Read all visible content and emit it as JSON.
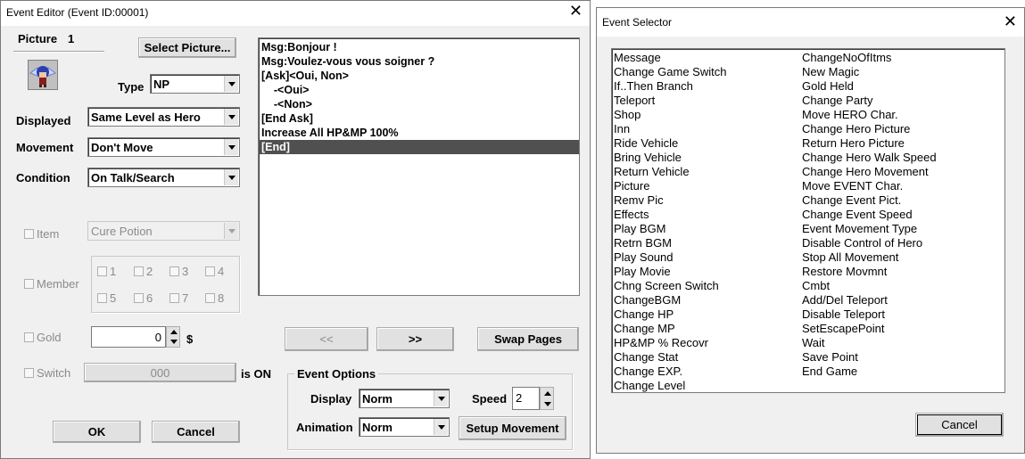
{
  "editor": {
    "title": "Event Editor (Event ID:00001)",
    "picture_label": "Picture",
    "picture_number": "1",
    "select_picture": "Select Picture...",
    "type_label": "Type",
    "type_value": "NP",
    "displayed_label": "Displayed",
    "displayed_value": "Same Level as Hero",
    "movement_label": "Movement",
    "movement_value": "Don't Move",
    "condition_label": "Condition",
    "condition_value": "On Talk/Search",
    "item_label": "Item",
    "item_value": "Cure Potion",
    "member_label": "Member",
    "members": [
      "1",
      "2",
      "3",
      "4",
      "5",
      "6",
      "7",
      "8"
    ],
    "gold_label": "Gold",
    "gold_value": "0",
    "gold_unit": "$",
    "switch_label": "Switch",
    "switch_value": "000",
    "is_on": "is ON",
    "commands": [
      "Msg:Bonjour !",
      "Msg:Voulez-vous vous soigner ?",
      "[Ask]<Oui, Non>",
      "    -<Oui>",
      "    -<Non>",
      "[End Ask]",
      "Increase All HP&MP 100%",
      "[End]"
    ],
    "prev_page": "<<",
    "next_page": ">>",
    "swap_pages": "Swap Pages",
    "event_options": "Event Options",
    "display_label": "Display",
    "display_value": "Norm",
    "speed_label": "Speed",
    "speed_value": "2",
    "animation_label": "Animation",
    "animation_value": "Norm",
    "setup_movement": "Setup Movement",
    "ok": "OK",
    "cancel": "Cancel"
  },
  "selector": {
    "title": "Event Selector",
    "col1": [
      "Message",
      "Change Game Switch",
      "If..Then Branch",
      "Teleport",
      "Shop",
      "Inn",
      "Ride Vehicle",
      "Bring Vehicle",
      "Return Vehicle",
      "Picture",
      "Remv Pic",
      "Effects",
      "Play BGM",
      "Retrn BGM",
      "Play Sound",
      "Play Movie",
      "Chng Screen Switch",
      "ChangeBGM",
      "Change HP",
      "Change MP",
      "HP&MP % Recovr",
      "Change Stat",
      "Change EXP.",
      "Change Level"
    ],
    "col2": [
      "ChangeNoOfItms",
      "New Magic",
      "Gold Held",
      "Change Party",
      "Move HERO Char.",
      "Change Hero Picture",
      "Return Hero Picture",
      "Change Hero Walk Speed",
      "Change Hero Movement",
      "Move EVENT Char.",
      "Change Event Pict.",
      "Change Event Speed",
      "Event Movement Type",
      "Disable Control of Hero",
      "Stop All Movement",
      "Restore Movmnt",
      "Cmbt",
      "Add/Del Teleport",
      "Disable Teleport",
      "SetEscapePoint",
      "Wait",
      "Save Point",
      "End Game"
    ],
    "cancel": "Cancel"
  },
  "colors": {
    "window_bg": "#f0f0f0",
    "selection": "#505050",
    "sprite_hair": "#2a3fb0",
    "sprite_wing": "#c9d6ff"
  }
}
